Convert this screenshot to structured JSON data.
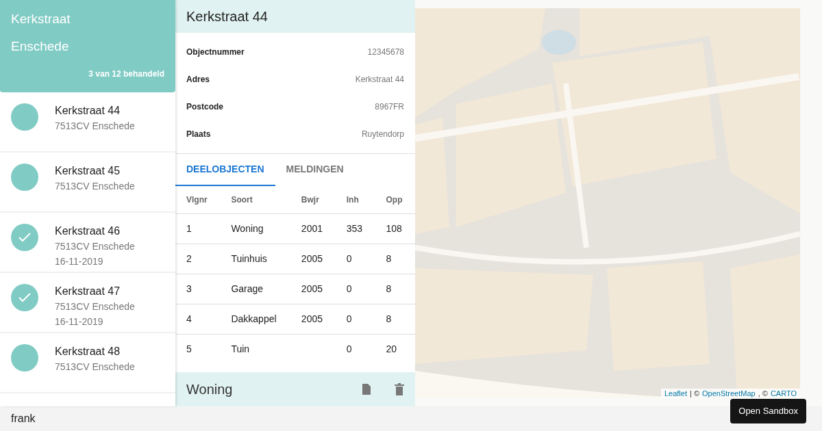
{
  "sidebar": {
    "title": "Kerkstraat",
    "subtitle": "Enschede",
    "progress": "3 van 12 behandeld",
    "items": [
      {
        "name": "Kerkstraat 44",
        "address": "7513CV Enschede",
        "done": false
      },
      {
        "name": "Kerkstraat 45",
        "address": "7513CV Enschede",
        "done": false
      },
      {
        "name": "Kerkstraat 46",
        "address": "7513CV Enschede",
        "date": "16-11-2019",
        "done": true
      },
      {
        "name": "Kerkstraat 47",
        "address": "7513CV Enschede",
        "date": "16-11-2019",
        "done": true
      },
      {
        "name": "Kerkstraat 48",
        "address": "7513CV Enschede",
        "done": false
      }
    ]
  },
  "detail": {
    "title": "Kerkstraat 44",
    "fields": [
      {
        "label": "Objectnummer",
        "value": "12345678"
      },
      {
        "label": "Adres",
        "value": "Kerkstraat 44"
      },
      {
        "label": "Postcode",
        "value": "8967FR"
      },
      {
        "label": "Plaats",
        "value": "Ruytendorp"
      }
    ],
    "tabs": [
      {
        "label": "DEELOBJECTEN",
        "selected": true
      },
      {
        "label": "MELDINGEN",
        "selected": false
      }
    ],
    "table": {
      "columns": [
        "Vlgnr",
        "Soort",
        "Bwjr",
        "Inh",
        "Opp"
      ],
      "rows": [
        [
          "1",
          "Woning",
          "2001",
          "353",
          "108"
        ],
        [
          "2",
          "Tuinhuis",
          "2005",
          "0",
          "8"
        ],
        [
          "3",
          "Garage",
          "2005",
          "0",
          "8"
        ],
        [
          "4",
          "Dakkappel",
          "2005",
          "0",
          "8"
        ],
        [
          "5",
          "Tuin",
          "",
          "0",
          "20"
        ]
      ]
    },
    "subpanel": {
      "title": "Woning"
    }
  },
  "map": {
    "kind": "picture",
    "attribution": [
      {
        "text": "Leaflet",
        "kind": "link"
      },
      {
        "text": "| ©",
        "kind": "text"
      },
      {
        "text": "OpenStreetMap",
        "kind": "link"
      },
      {
        "text": ", ©",
        "kind": "text"
      },
      {
        "text": "CARTO",
        "kind": "link"
      }
    ]
  },
  "footer": {
    "user": "frank"
  },
  "sandbox_button": "Open Sandbox"
}
